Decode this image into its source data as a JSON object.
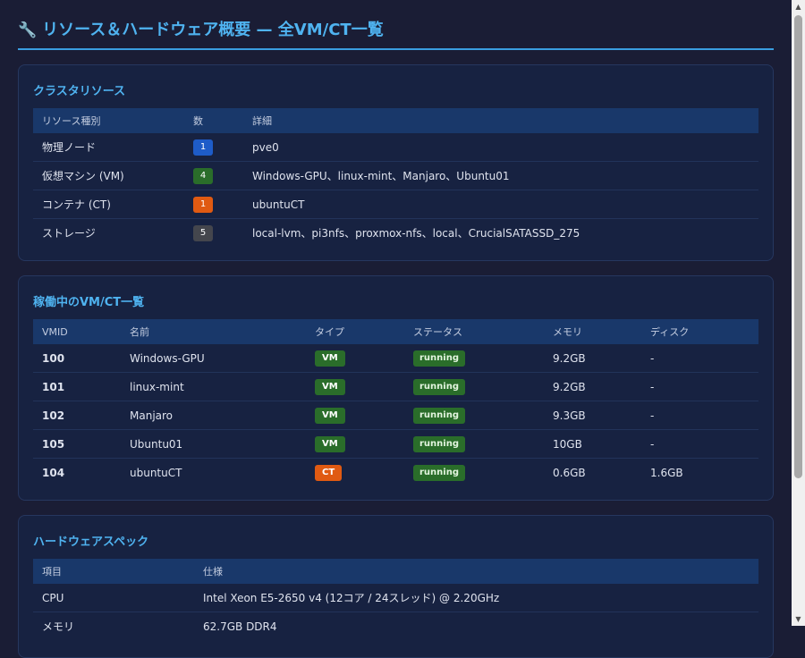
{
  "page": {
    "icon": "wrench-icon",
    "icon_glyph": "🔧",
    "title": "リソース＆ハードウェア概要 — 全VM/CT一覧"
  },
  "colors": {
    "accent": "#4fb3f0",
    "blue": "#1e5cc8",
    "green": "#2a6d2a",
    "orange": "#e05a12",
    "gray": "#44464d",
    "running": "#2a6d2a"
  },
  "cluster": {
    "title": "クラスタリソース",
    "headers": [
      "リソース種別",
      "数",
      "詳細"
    ],
    "rows": [
      {
        "type": "物理ノード",
        "count": "1",
        "color": "#1e5cc8",
        "detail": "pve0"
      },
      {
        "type": "仮想マシン (VM)",
        "count": "4",
        "color": "#2a6d2a",
        "detail": "Windows-GPU、linux-mint、Manjaro、Ubuntu01"
      },
      {
        "type": "コンテナ (CT)",
        "count": "1",
        "color": "#e05a12",
        "detail": "ubuntuCT"
      },
      {
        "type": "ストレージ",
        "count": "5",
        "color": "#44464d",
        "detail": "local-lvm、pi3nfs、proxmox-nfs、local、CrucialSATASSD_275"
      }
    ]
  },
  "running": {
    "title": "稼働中のVM/CT一覧",
    "headers": [
      "VMID",
      "名前",
      "タイプ",
      "ステータス",
      "メモリ",
      "ディスク"
    ],
    "rows": [
      {
        "vmid": "100",
        "name": "Windows-GPU",
        "type": "VM",
        "type_color": "#2a6d2a",
        "status": "running",
        "memory": "9.2GB",
        "disk": "-"
      },
      {
        "vmid": "101",
        "name": "linux-mint",
        "type": "VM",
        "type_color": "#2a6d2a",
        "status": "running",
        "memory": "9.2GB",
        "disk": "-"
      },
      {
        "vmid": "102",
        "name": "Manjaro",
        "type": "VM",
        "type_color": "#2a6d2a",
        "status": "running",
        "memory": "9.3GB",
        "disk": "-"
      },
      {
        "vmid": "105",
        "name": "Ubuntu01",
        "type": "VM",
        "type_color": "#2a6d2a",
        "status": "running",
        "memory": "10GB",
        "disk": "-"
      },
      {
        "vmid": "104",
        "name": "ubuntuCT",
        "type": "CT",
        "type_color": "#e05a12",
        "status": "running",
        "memory": "0.6GB",
        "disk": "1.6GB"
      }
    ]
  },
  "hardware": {
    "title": "ハードウェアスペック",
    "headers": [
      "項目",
      "仕様"
    ],
    "rows": [
      {
        "item": "CPU",
        "spec": "Intel Xeon E5-2650 v4 (12コア / 24スレッド) @ 2.20GHz"
      },
      {
        "item": "メモリ",
        "spec": "62.7GB DDR4"
      }
    ]
  },
  "scrollbar": {
    "up_icon": "scroll-up-arrow-icon",
    "down_icon": "scroll-down-arrow-icon"
  }
}
